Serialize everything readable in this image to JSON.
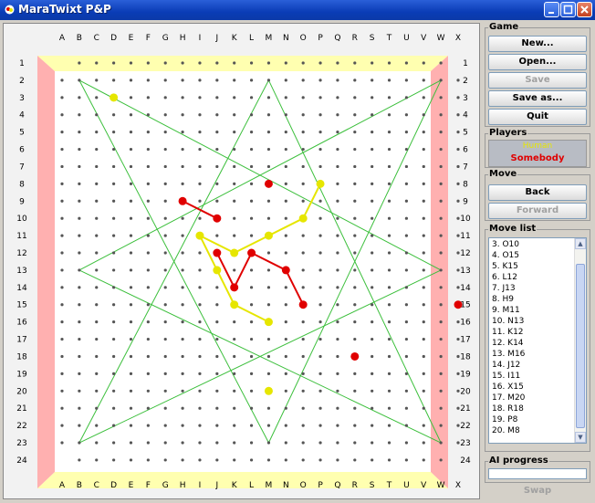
{
  "window": {
    "title": "MaraTwixt P&P"
  },
  "board": {
    "columns": [
      "A",
      "B",
      "C",
      "D",
      "E",
      "F",
      "G",
      "H",
      "I",
      "J",
      "K",
      "L",
      "M",
      "N",
      "O",
      "P",
      "Q",
      "R",
      "S",
      "T",
      "U",
      "V",
      "W",
      "X"
    ],
    "rows": [
      "1",
      "2",
      "3",
      "4",
      "5",
      "6",
      "7",
      "8",
      "9",
      "10",
      "11",
      "12",
      "13",
      "14",
      "15",
      "16",
      "17",
      "18",
      "19",
      "20",
      "21",
      "22",
      "23",
      "24"
    ],
    "pegs": [
      {
        "cell": "D3",
        "player": "yellow"
      },
      {
        "cell": "M8",
        "player": "red"
      },
      {
        "cell": "P8",
        "player": "yellow"
      },
      {
        "cell": "H9",
        "player": "red"
      },
      {
        "cell": "J10",
        "player": "red"
      },
      {
        "cell": "O10",
        "player": "yellow"
      },
      {
        "cell": "I11",
        "player": "yellow"
      },
      {
        "cell": "M11",
        "player": "yellow"
      },
      {
        "cell": "J12",
        "player": "red"
      },
      {
        "cell": "K12",
        "player": "yellow"
      },
      {
        "cell": "L12",
        "player": "red"
      },
      {
        "cell": "J13",
        "player": "yellow"
      },
      {
        "cell": "N13",
        "player": "red"
      },
      {
        "cell": "K14",
        "player": "red"
      },
      {
        "cell": "K15",
        "player": "yellow"
      },
      {
        "cell": "O15",
        "player": "red"
      },
      {
        "cell": "X15",
        "player": "red"
      },
      {
        "cell": "M16",
        "player": "yellow"
      },
      {
        "cell": "R18",
        "player": "red"
      },
      {
        "cell": "M20",
        "player": "yellow"
      }
    ],
    "links": [
      {
        "from": "H9",
        "to": "J10",
        "player": "red"
      },
      {
        "from": "J12",
        "to": "K14",
        "player": "red"
      },
      {
        "from": "K14",
        "to": "L12",
        "player": "red"
      },
      {
        "from": "L12",
        "to": "N13",
        "player": "red"
      },
      {
        "from": "N13",
        "to": "O15",
        "player": "red"
      },
      {
        "from": "P8",
        "to": "O10",
        "player": "yellow"
      },
      {
        "from": "O10",
        "to": "M11",
        "player": "yellow"
      },
      {
        "from": "M11",
        "to": "K12",
        "player": "yellow"
      },
      {
        "from": "K12",
        "to": "I11",
        "player": "yellow"
      },
      {
        "from": "I11",
        "to": "J13",
        "player": "yellow"
      },
      {
        "from": "J13",
        "to": "K15",
        "player": "yellow"
      },
      {
        "from": "K15",
        "to": "M16",
        "player": "yellow"
      }
    ],
    "colors": {
      "yellow": "#e6e600",
      "red": "#e00000",
      "guide": "#3cbf3c",
      "top_bottom_border": "#ffffb0",
      "left_right_border": "#ffb0b0",
      "hole": "#555555"
    }
  },
  "game_panel": {
    "title": "Game",
    "new_label": "New...",
    "open_label": "Open...",
    "save_label": "Save",
    "save_as_label": "Save as...",
    "quit_label": "Quit"
  },
  "players_panel": {
    "title": "Players",
    "player1": "Human",
    "player2": "Somebody"
  },
  "move_panel": {
    "title": "Move",
    "back_label": "Back",
    "forward_label": "Forward"
  },
  "move_list": {
    "title": "Move list",
    "items": [
      "3. O10",
      "4. O15",
      "5. K15",
      "6. L12",
      "7. J13",
      "8. H9",
      "9. M11",
      "10. N13",
      "11. K12",
      "12. K14",
      "13. M16",
      "14. J12",
      "15. I11",
      "16. X15",
      "17. M20",
      "18. R18",
      "19. P8",
      "20. M8"
    ]
  },
  "ai_progress": {
    "title": "AI progress",
    "value": 0
  },
  "swap_label": "Swap"
}
